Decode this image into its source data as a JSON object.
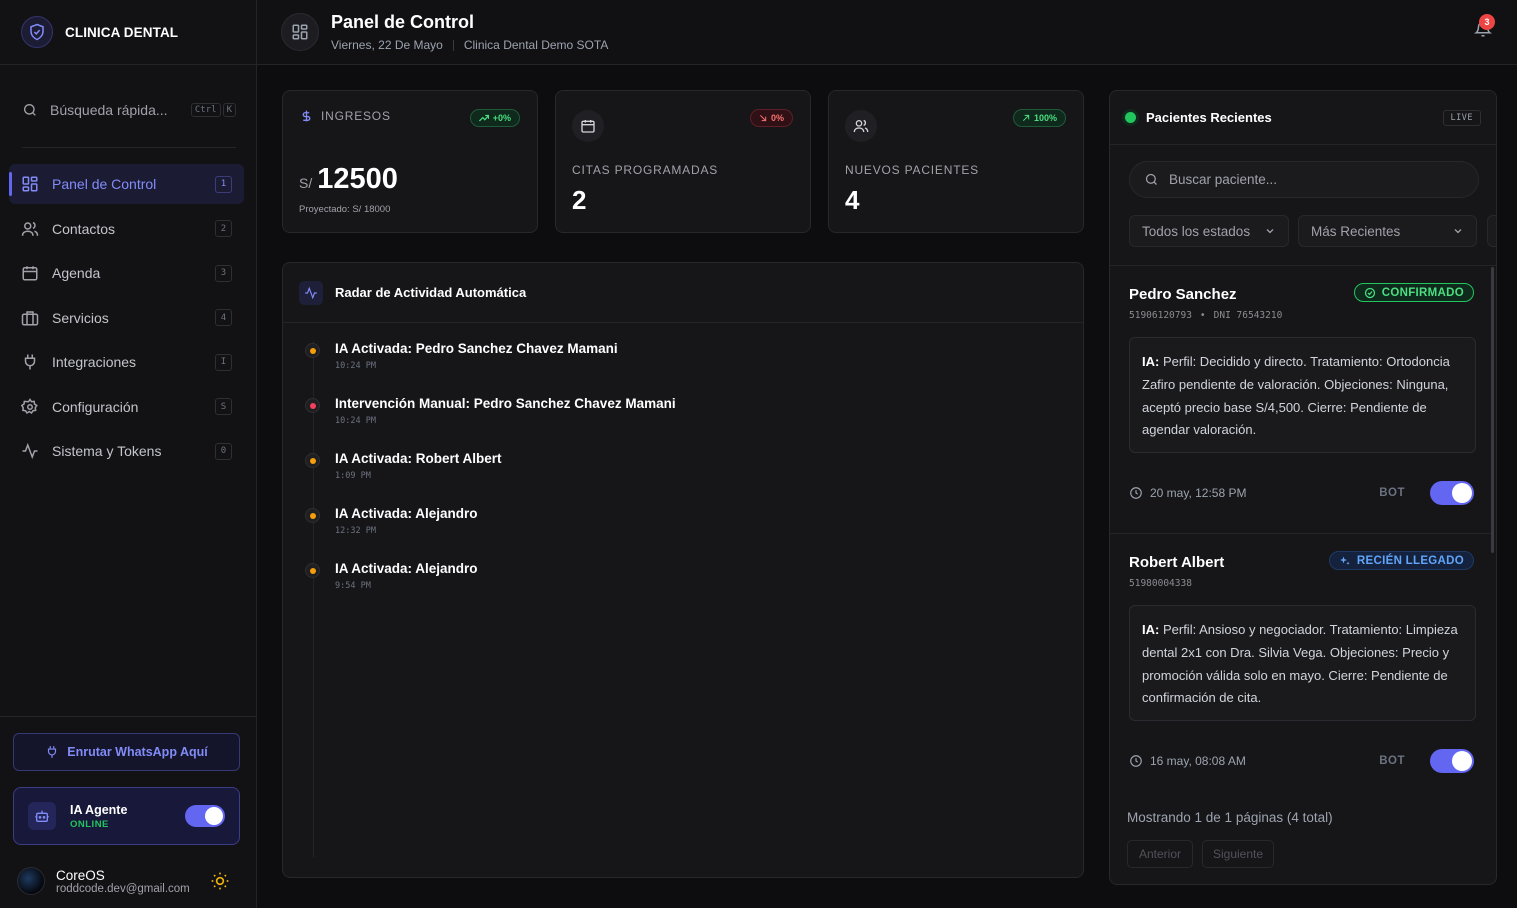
{
  "brand": {
    "name": "CLINICA DENTAL"
  },
  "sidebar": {
    "search_placeholder": "Búsqueda rápida...",
    "shortcut": [
      "Ctrl",
      "K"
    ],
    "items": [
      {
        "label": "Panel de Control",
        "key": "1",
        "icon": "grid-icon"
      },
      {
        "label": "Contactos",
        "key": "2",
        "icon": "users-icon"
      },
      {
        "label": "Agenda",
        "key": "3",
        "icon": "calendar-icon"
      },
      {
        "label": "Servicios",
        "key": "4",
        "icon": "briefcase-icon"
      },
      {
        "label": "Integraciones",
        "key": "I",
        "icon": "plug-icon"
      },
      {
        "label": "Configuración",
        "key": "S",
        "icon": "gear-icon"
      },
      {
        "label": "Sistema y Tokens",
        "key": "0",
        "icon": "activity-icon"
      }
    ],
    "whatsapp_button": "Enrutar WhatsApp Aquí",
    "agent": {
      "name": "IA Agente",
      "status": "ONLINE",
      "enabled": true
    },
    "user": {
      "name": "CoreOS",
      "email": "roddcode.dev@gmail.com"
    }
  },
  "header": {
    "title": "Panel de Control",
    "date": "Viernes, 22 De Mayo",
    "clinic": "Clinica Dental Demo SOTA",
    "notifications": "3"
  },
  "stats": {
    "income": {
      "label": "INGRESOS",
      "change": "+0%",
      "currency": "S/",
      "value": "12500",
      "projected": "Proyectado: S/ 18000"
    },
    "appointments": {
      "label": "CITAS PROGRAMADAS",
      "change": "0%",
      "value": "2"
    },
    "new_patients": {
      "label": "NUEVOS PACIENTES",
      "change": "100%",
      "value": "4"
    }
  },
  "radar": {
    "title": "Radar de Actividad Automática",
    "events": [
      {
        "title": "IA Activada: Pedro Sanchez Chavez Mamani",
        "time": "10:24 PM",
        "color": "#f59e0b"
      },
      {
        "title": "Intervención Manual: Pedro Sanchez Chavez Mamani",
        "time": "10:24 PM",
        "color": "#f43f5e"
      },
      {
        "title": "IA Activada: Robert Albert",
        "time": "1:09 PM",
        "color": "#f59e0b"
      },
      {
        "title": "IA Activada: Alejandro",
        "time": "12:32 PM",
        "color": "#f59e0b"
      },
      {
        "title": "IA Activada: Alejandro",
        "time": "9:54 PM",
        "color": "#f59e0b"
      }
    ]
  },
  "patients": {
    "title": "Pacientes Recientes",
    "live": "LIVE",
    "search_placeholder": "Buscar paciente...",
    "filter_status": "Todos los estados",
    "filter_sort": "Más Recientes",
    "list": [
      {
        "name": "Pedro Sanchez",
        "phone": "51906120793",
        "dni": "DNI 76543210",
        "status": "CONFIRMADO",
        "note_label": "IA:",
        "note": "Perfil: Decidido y directo. Tratamiento: Ortodoncia Zafiro pendiente de valoración. Objeciones: Ninguna, aceptó precio base S/4,500. Cierre: Pendiente de agendar valoración.",
        "date": "20 may, 12:58 PM",
        "bot_label": "BOT",
        "bot": true
      },
      {
        "name": "Robert Albert",
        "phone": "51980004338",
        "status": "RECIÉN LLEGADO",
        "note_label": "IA:",
        "note": "Perfil: Ansioso y negociador. Tratamiento: Limpieza dental 2x1 con Dra. Silvia Vega. Objeciones: Precio y promoción válida solo en mayo. Cierre: Pendiente de confirmación de cita.",
        "date": "16 may, 08:08 AM",
        "bot_label": "BOT",
        "bot": true
      }
    ],
    "pager": "Mostrando 1 de 1 páginas (4 total)",
    "prev": "Anterior",
    "next": "Siguiente"
  }
}
